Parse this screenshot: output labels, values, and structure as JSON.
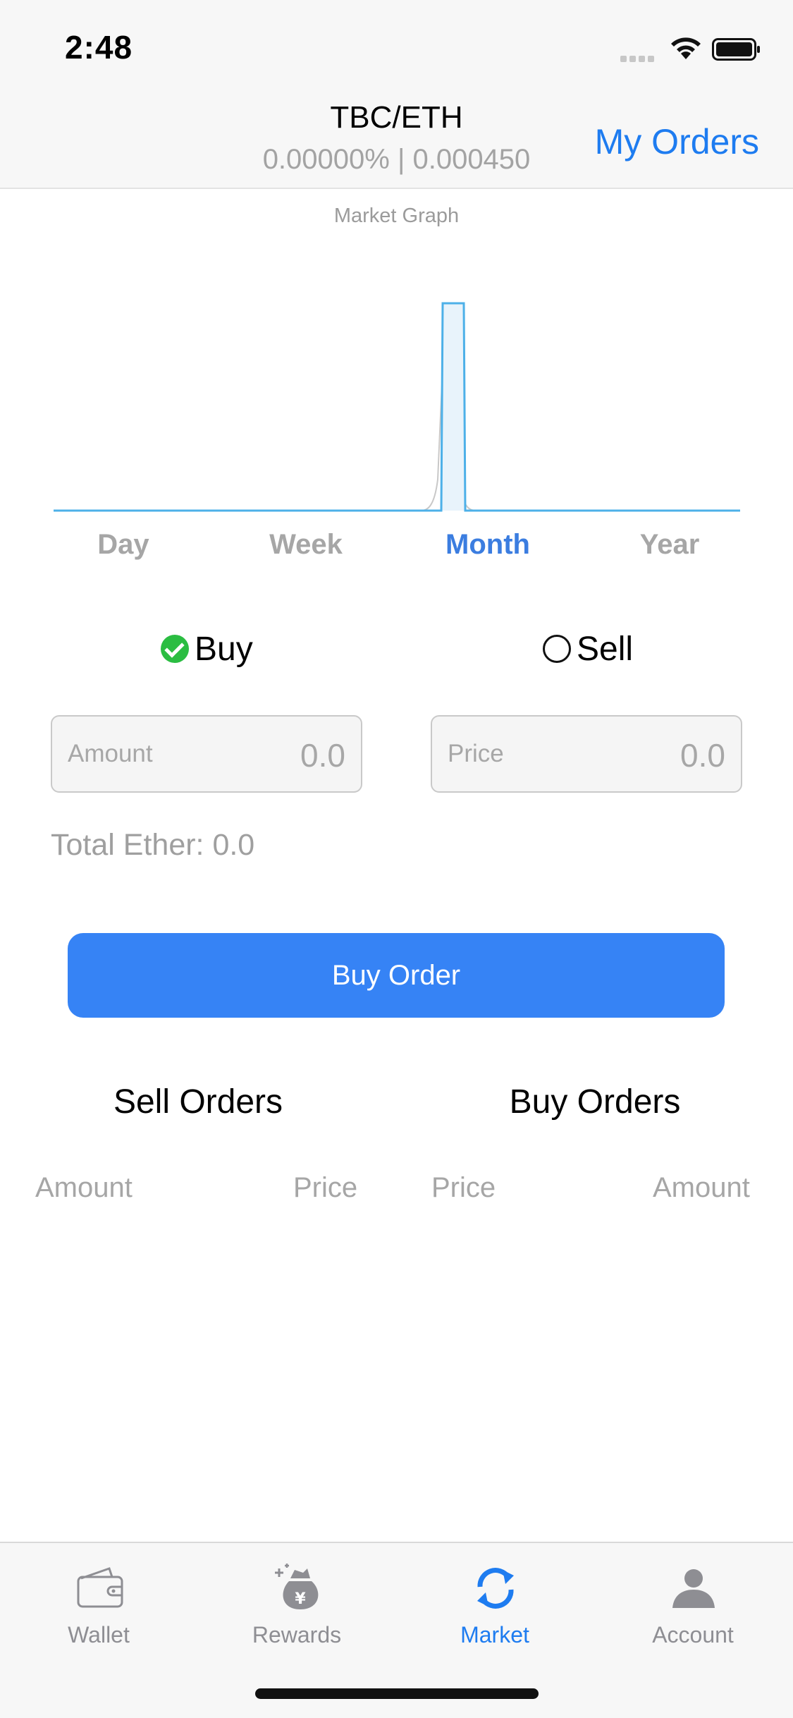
{
  "status_bar": {
    "time": "2:48"
  },
  "nav": {
    "title": "TBC/ETH",
    "subtitle": "0.00000% | 0.000450",
    "my_orders": "My Orders"
  },
  "graph": {
    "label": "Market Graph"
  },
  "periods": [
    {
      "label": "Day",
      "active": false
    },
    {
      "label": "Week",
      "active": false
    },
    {
      "label": "Month",
      "active": true
    },
    {
      "label": "Year",
      "active": false
    }
  ],
  "trade": {
    "buy_label": "Buy",
    "sell_label": "Sell",
    "selected": "Buy",
    "amount_placeholder": "Amount",
    "amount_value": "0.0",
    "price_placeholder": "Price",
    "price_value": "0.0",
    "total": "Total Ether: 0.0",
    "submit_label": "Buy Order"
  },
  "orders": {
    "sell_title": "Sell Orders",
    "buy_title": "Buy Orders",
    "sell_columns": [
      "Amount",
      "Price"
    ],
    "buy_columns": [
      "Price",
      "Amount"
    ]
  },
  "tabs": [
    {
      "label": "Wallet",
      "icon": "wallet-icon",
      "active": false
    },
    {
      "label": "Rewards",
      "icon": "rewards-bag-icon",
      "active": false
    },
    {
      "label": "Market",
      "icon": "market-sync-icon",
      "active": true
    },
    {
      "label": "Account",
      "icon": "account-icon",
      "active": false
    }
  ],
  "colors": {
    "accent": "#1e7cf0",
    "button": "#3683f5",
    "check_green": "#2bbd42",
    "graph_line": "#4db0e8"
  }
}
